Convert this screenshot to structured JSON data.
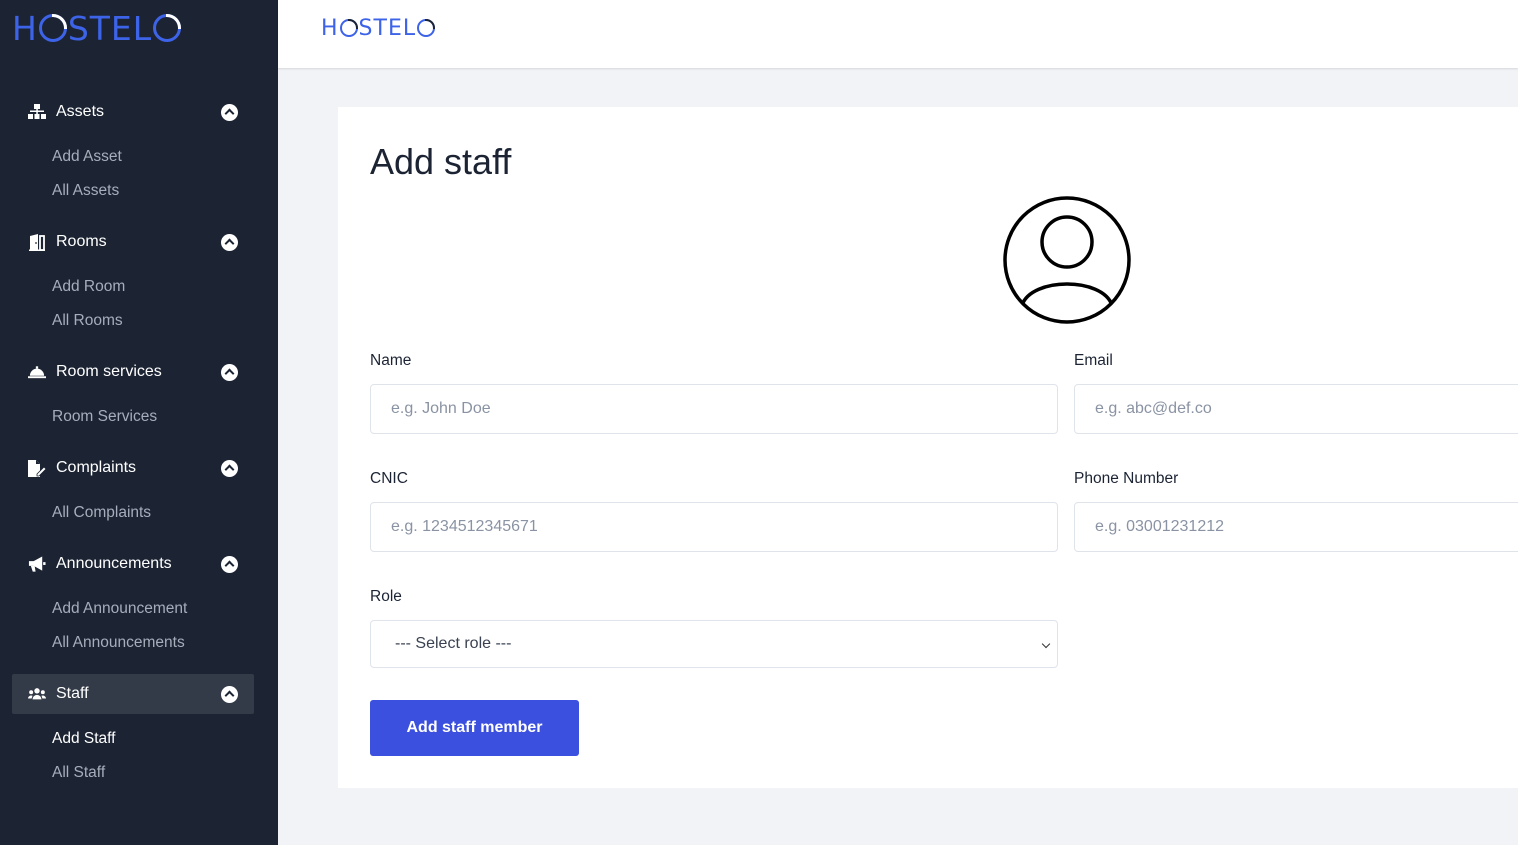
{
  "brand": {
    "left": "H",
    "right": "STEL",
    "end": ""
  },
  "sidebar": {
    "groups": [
      {
        "label": "Assets",
        "icon": "sitemap-icon",
        "items": [
          "Add Asset",
          "All Assets"
        ]
      },
      {
        "label": "Rooms",
        "icon": "door-icon",
        "items": [
          "Add Room",
          "All Rooms"
        ]
      },
      {
        "label": "Room services",
        "icon": "bell-icon",
        "items": [
          "Room Services"
        ]
      },
      {
        "label": "Complaints",
        "icon": "file-edit-icon",
        "items": [
          "All Complaints"
        ]
      },
      {
        "label": "Announcements",
        "icon": "megaphone-icon",
        "items": [
          "Add Announcement",
          "All Announcements"
        ]
      },
      {
        "label": "Staff",
        "icon": "users-icon",
        "items": [
          "Add Staff",
          "All Staff"
        ]
      }
    ]
  },
  "topbar": {
    "brand_left": "H",
    "brand_right": "STEL"
  },
  "form": {
    "title": "Add staff",
    "name_label": "Name",
    "name_placeholder": "e.g. John Doe",
    "email_label": "Email",
    "email_placeholder": "e.g. abc@def.co",
    "cnic_label": "CNIC",
    "cnic_placeholder": "e.g. 1234512345671",
    "phone_label": "Phone Number",
    "phone_placeholder": "e.g. 03001231212",
    "role_label": "Role",
    "role_selected": "--- Select role ---",
    "submit_label": "Add staff member"
  },
  "colors": {
    "sidebar": "#1c2434",
    "accent": "#3c50e0",
    "brand": "#3d63e8"
  }
}
